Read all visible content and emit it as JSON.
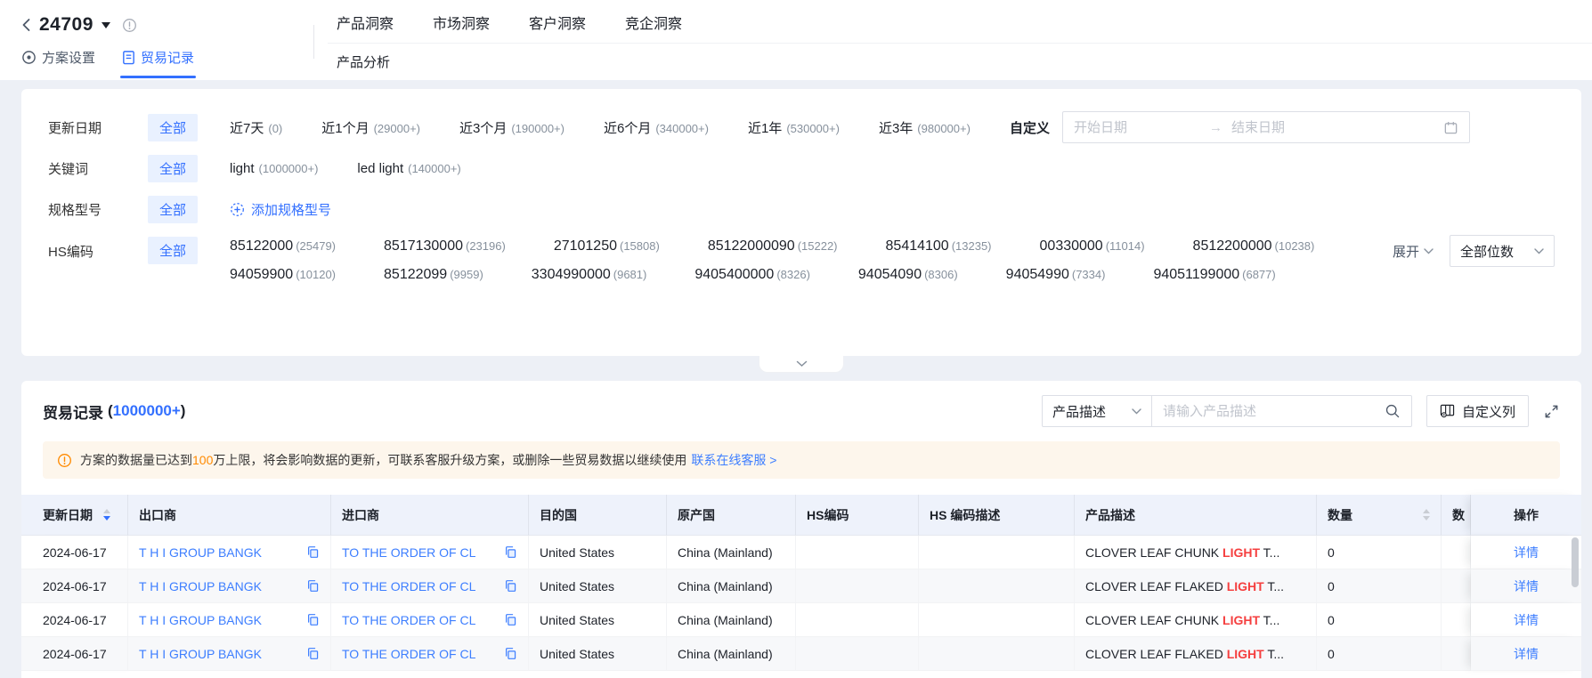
{
  "colors": {
    "accent": "#3370FF",
    "link": "#3D7EFF",
    "warning_orange": "#FF8A00",
    "highlight_red": "#F53F3F",
    "banner_bg": "#FDF6EC",
    "table_header_bg": "#EEF2FB"
  },
  "topbar": {
    "title": "24709",
    "nav": [
      "产品洞察",
      "市场洞察",
      "客户洞察",
      "竞企洞察"
    ],
    "subnav": "产品分析",
    "tabs": {
      "settings": "方案设置",
      "records": "贸易记录"
    }
  },
  "filters": {
    "date": {
      "label": "更新日期",
      "all": "全部",
      "options": [
        {
          "text": "近7天",
          "count": "(0)"
        },
        {
          "text": "近1个月",
          "count": "(29000+)"
        },
        {
          "text": "近3个月",
          "count": "(190000+)"
        },
        {
          "text": "近6个月",
          "count": "(340000+)"
        },
        {
          "text": "近1年",
          "count": "(530000+)"
        },
        {
          "text": "近3年",
          "count": "(980000+)"
        }
      ],
      "custom": "自定义",
      "start_placeholder": "开始日期",
      "end_placeholder": "结束日期"
    },
    "keyword": {
      "label": "关键词",
      "all": "全部",
      "options": [
        {
          "text": "light",
          "count": "(1000000+)"
        },
        {
          "text": "led light",
          "count": "(140000+)"
        }
      ]
    },
    "spec": {
      "label": "规格型号",
      "all": "全部",
      "add": "添加规格型号"
    },
    "hs": {
      "label": "HS编码",
      "all": "全部",
      "codes": [
        {
          "code": "85122000",
          "count": "(25479)"
        },
        {
          "code": "8517130000",
          "count": "(23196)"
        },
        {
          "code": "27101250",
          "count": "(15808)"
        },
        {
          "code": "85122000090",
          "count": "(15222)"
        },
        {
          "code": "85414100",
          "count": "(13235)"
        },
        {
          "code": "00330000",
          "count": "(11014)"
        },
        {
          "code": "8512200000",
          "count": "(10238)"
        },
        {
          "code": "94059900",
          "count": "(10120)"
        },
        {
          "code": "85122099",
          "count": "(9959)"
        },
        {
          "code": "3304990000",
          "count": "(9681)"
        },
        {
          "code": "9405400000",
          "count": "(8326)"
        },
        {
          "code": "94054090",
          "count": "(8306)"
        },
        {
          "code": "94054990",
          "count": "(7334)"
        },
        {
          "code": "94051199000",
          "count": "(6877)"
        }
      ],
      "expand": "展开",
      "digits": "全部位数"
    }
  },
  "records": {
    "title": "贸易记录",
    "count_open": "(",
    "count_num": "1000000+",
    "count_close": ")",
    "search": {
      "field": "产品描述",
      "placeholder": "请输入产品描述"
    },
    "customize": "自定义列",
    "warning": {
      "pre": "方案的数据量已达到",
      "num": "100",
      "post": "万上限，将会影响数据的更新，可联系客服升级方案，或删除一些贸易数据以继续使用",
      "link": "联系在线客服 >"
    },
    "table": {
      "headers": {
        "date": "更新日期",
        "exporter": "出口商",
        "importer": "进口商",
        "destination": "目的国",
        "origin": "原产国",
        "hs": "HS编码",
        "hs_desc": "HS 编码描述",
        "product": "产品描述",
        "quantity": "数量",
        "unit": "数",
        "action": "操作"
      },
      "rows": [
        {
          "date": "2024-06-17",
          "exporter": "T H I GROUP BANGK",
          "importer": "TO THE ORDER OF CL",
          "destination": "United States",
          "origin": "China (Mainland)",
          "hs_code": "",
          "hs_desc": "",
          "product_pre": "CLOVER LEAF CHUNK ",
          "product_highlight": "LIGHT",
          "product_post": " T...",
          "quantity": "0",
          "unit": "",
          "action": "详情"
        },
        {
          "date": "2024-06-17",
          "exporter": "T H I GROUP BANGK",
          "importer": "TO THE ORDER OF CL",
          "destination": "United States",
          "origin": "China (Mainland)",
          "hs_code": "",
          "hs_desc": "",
          "product_pre": "CLOVER LEAF FLAKED ",
          "product_highlight": "LIGHT",
          "product_post": " T...",
          "quantity": "0",
          "unit": "",
          "action": "详情"
        },
        {
          "date": "2024-06-17",
          "exporter": "T H I GROUP BANGK",
          "importer": "TO THE ORDER OF CL",
          "destination": "United States",
          "origin": "China (Mainland)",
          "hs_code": "",
          "hs_desc": "",
          "product_pre": "CLOVER LEAF CHUNK ",
          "product_highlight": "LIGHT",
          "product_post": " T...",
          "quantity": "0",
          "unit": "",
          "action": "详情"
        },
        {
          "date": "2024-06-17",
          "exporter": "T H I GROUP BANGK",
          "importer": "TO THE ORDER OF CL",
          "destination": "United States",
          "origin": "China (Mainland)",
          "hs_code": "",
          "hs_desc": "",
          "product_pre": "CLOVER LEAF FLAKED ",
          "product_highlight": "LIGHT",
          "product_post": " T...",
          "quantity": "0",
          "unit": "",
          "action": "详情"
        }
      ]
    }
  }
}
